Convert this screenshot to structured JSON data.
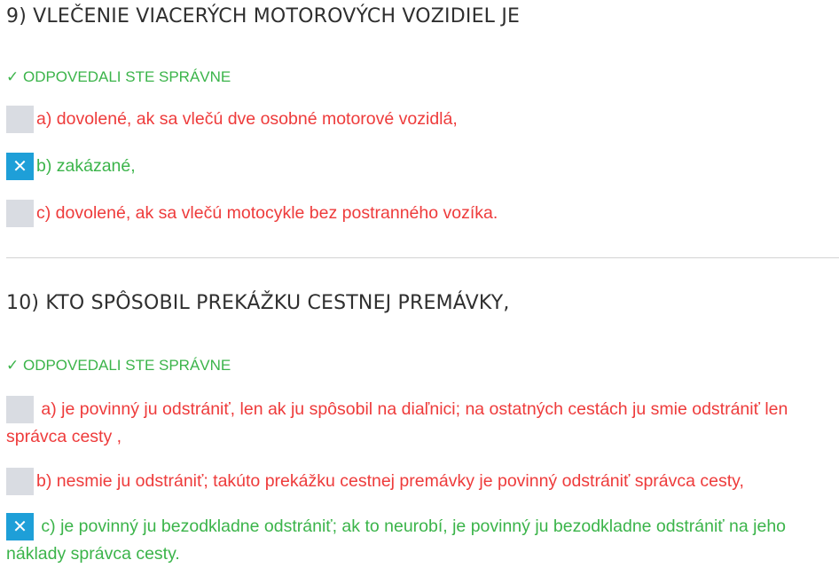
{
  "questions": [
    {
      "title": "9) VLEČENIE VIACERÝCH MOTOROVÝCH VOZIDIEL JE",
      "result": "✓ ODPOVEDALI STE SPRÁVNE",
      "answers": [
        {
          "text": "a) dovolené, ak sa vlečú dve osobné motorové vozidlá,",
          "checked": false,
          "status": "wrong"
        },
        {
          "text": "b) zakázané,",
          "checked": true,
          "status": "correct"
        },
        {
          "text": "c) dovolené, ak sa vlečú motocykle bez postranného vozíka.",
          "checked": false,
          "status": "wrong"
        }
      ]
    },
    {
      "title": "10) KTO SPÔSOBIL PREKÁŽKU CESTNEJ PREMÁVKY,",
      "result": "✓ ODPOVEDALI STE SPRÁVNE",
      "answers": [
        {
          "text": "a) je povinný ju odstrániť, len ak ju spôsobil na diaľnici; na ostatných cestách ju smie odstrániť len správca cesty ,",
          "checked": false,
          "status": "wrong"
        },
        {
          "text": "b) nesmie ju odstrániť; takúto prekážku cestnej premávky je povinný odstrániť správca cesty,",
          "checked": false,
          "status": "wrong"
        },
        {
          "text": "c) je povinný ju bezodkladne odstrániť; ak to neurobí, je povinný ju bezodkladne odstrániť na jeho náklady správca cesty.",
          "checked": true,
          "status": "correct"
        }
      ]
    }
  ],
  "icons": {
    "checked_mark": "✕",
    "checked_color": "#1e9fd8",
    "unchecked_color": "#d9dce2",
    "correct_color": "#3bb44a",
    "wrong_color": "#ee3b3b"
  }
}
